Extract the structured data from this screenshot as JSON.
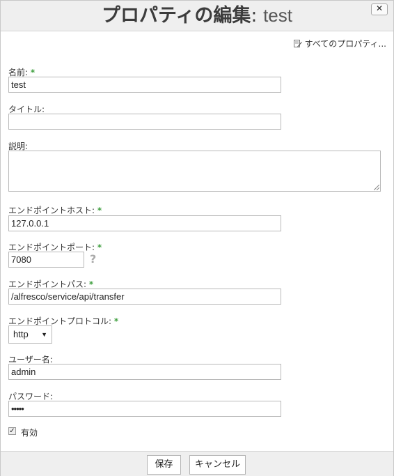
{
  "dialog": {
    "title_main": "プロパティの編集",
    "title_colon": ": ",
    "title_name": "test",
    "close_label": "✕"
  },
  "all_properties": {
    "label": "すべてのプロパティ...",
    "icon": "edit-icon"
  },
  "fields": {
    "name": {
      "label": "名前:",
      "required": "*",
      "value": "test"
    },
    "title": {
      "label": "タイトル:",
      "value": ""
    },
    "description": {
      "label": "説明:",
      "value": ""
    },
    "endpoint_host": {
      "label": "エンドポイントホスト:",
      "required": "*",
      "value": "127.0.0.1"
    },
    "endpoint_port": {
      "label": "エンドポイントポート:",
      "required": "*",
      "value": "7080",
      "help": "?"
    },
    "endpoint_path": {
      "label": "エンドポイントパス:",
      "required": "*",
      "value": "/alfresco/service/api/transfer"
    },
    "endpoint_protocol": {
      "label": "エンドポイントプロトコル:",
      "required": "*",
      "value": "http"
    },
    "username": {
      "label": "ユーザー名:",
      "value": "admin"
    },
    "password": {
      "label": "パスワード:",
      "value": "•••••"
    },
    "enabled": {
      "label": "有効",
      "checked": true,
      "check_mark": "✓"
    }
  },
  "footer": {
    "save_label": "保存",
    "cancel_label": "キャンセル"
  },
  "colors": {
    "required": "#3f9f3f",
    "header_bg": "#efefef",
    "border": "#b8b8b8"
  }
}
